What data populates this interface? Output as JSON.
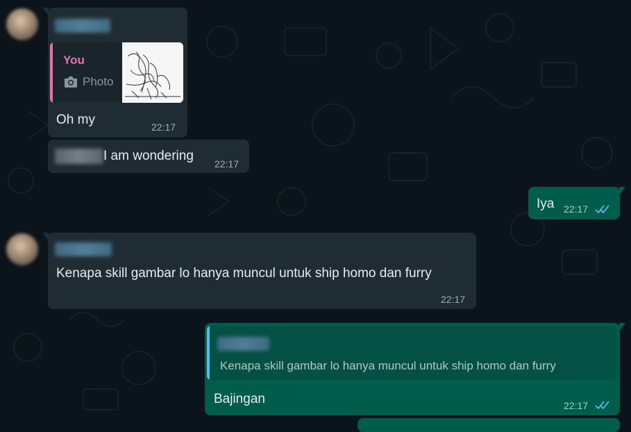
{
  "messages": [
    {
      "direction": "incoming",
      "quoted": {
        "author": "You",
        "kind_label": "Photo",
        "icon": "camera-icon"
      },
      "text": "Oh my",
      "time": "22:17"
    },
    {
      "direction": "incoming",
      "text": "I am wondering",
      "time": "22:17"
    },
    {
      "direction": "outgoing",
      "text": "Iya",
      "time": "22:17",
      "status": "read"
    },
    {
      "direction": "incoming",
      "text": "Kenapa skill gambar lo hanya muncul untuk ship homo dan furry",
      "time": "22:17"
    },
    {
      "direction": "outgoing",
      "quoted": {
        "text": "Kenapa skill gambar lo hanya muncul untuk ship homo dan furry"
      },
      "text": "Bajingan",
      "time": "22:17",
      "status": "read"
    }
  ],
  "colors": {
    "chat_background": "#0b141a",
    "incoming_bubble": "#202c33",
    "outgoing_bubble": "#005c4b",
    "quote_you_accent": "#ee6db0",
    "quote_other_accent": "#53bdeb",
    "read_ticks": "#53bdeb"
  }
}
